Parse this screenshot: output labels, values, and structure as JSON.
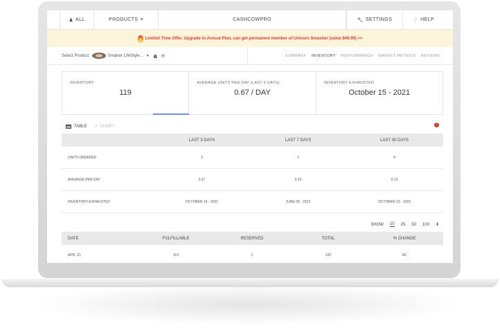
{
  "nav": {
    "all": "ALL",
    "products": "PRODUCTS",
    "brand": "CASHCOWPRO",
    "settings": "SETTINGS",
    "help": "HELP"
  },
  "promo": {
    "text": "Limited Time Offer. Upgrade to Annual Plan, can get permanent member of Unicorn Smasher (value $49.99) >>"
  },
  "product": {
    "label": "Select Product:",
    "name": "Smarter LifeStyle...",
    "marketplace_logo": "a"
  },
  "tabs": [
    "SUMMARY",
    "INVENTORY",
    "PERFORMANCE",
    "MARKET METRICS",
    "REVIEWS"
  ],
  "active_tab": "INVENTORY",
  "cards": [
    {
      "label": "INVENTORY",
      "value": "119"
    },
    {
      "label": "AVERAGE UNITS PER DAY (LAST 3 DAYS)",
      "value": "0.67 / DAY"
    },
    {
      "label": "INVENTORY EXHAUSTED",
      "value": "October 15 - 2021"
    }
  ],
  "view_toggle": {
    "table": "TABLE",
    "chart": "CHART",
    "help": "?"
  },
  "summary_table": {
    "headers": [
      "",
      "LAST 3 DAYS",
      "LAST 7 DAYS",
      "LAST 30 DAYS"
    ],
    "rows": [
      [
        "UNITS ORDERED",
        "2",
        "2",
        "4"
      ],
      [
        "AVERAGE PER DAY",
        "0.67",
        "0.29",
        "0.13"
      ],
      [
        "INVENTORY EXHAUSTED",
        "OCTOBER 15 - 2021",
        "JUNE 05 - 2022",
        "OCTOBER 23 - 2023"
      ]
    ]
  },
  "pagination": {
    "show_label": "SHOW",
    "options": [
      "10",
      "25",
      "50",
      "100"
    ],
    "selected": "10"
  },
  "history_table": {
    "headers": [
      "DATE",
      "FULFILLABLE",
      "RESERVED",
      "TOTAL",
      "% CHANGE"
    ],
    "rows": [
      [
        "APR, 21",
        "119",
        "1",
        "120",
        "NC"
      ]
    ]
  },
  "colors": {
    "promo_text": "#e53b2c",
    "promo_bg": "#fdf4dc",
    "active_indicator": "#6f8fd9",
    "help_badge": "#d9342b"
  }
}
